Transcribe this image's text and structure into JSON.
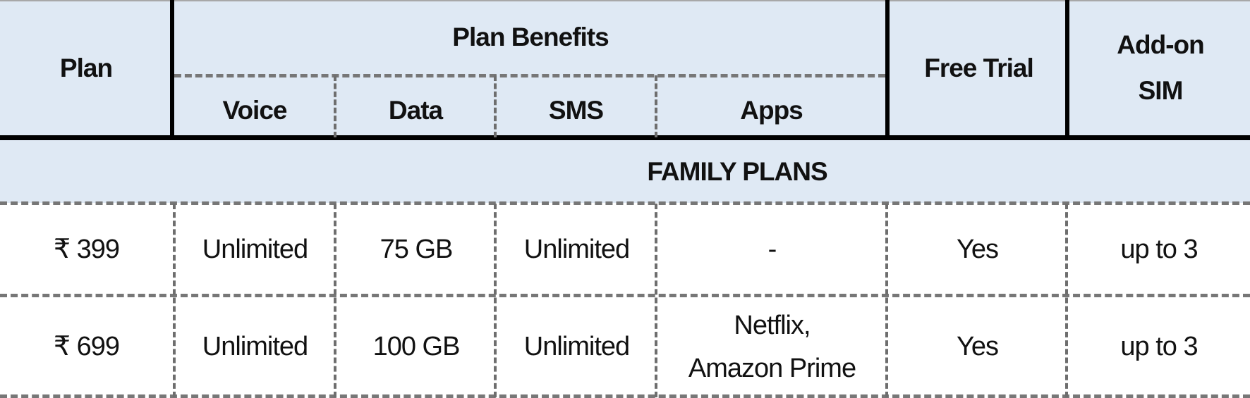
{
  "table": {
    "header": {
      "plan": "Plan",
      "plan_benefits": "Plan Benefits",
      "voice": "Voice",
      "data": "Data",
      "sms": "SMS",
      "apps": "Apps",
      "free_trial": "Free Trial",
      "addon_sim_line1": "Add-on",
      "addon_sim_line2": "SIM"
    },
    "section_title": "FAMILY PLANS",
    "rows": [
      {
        "plan": "₹ 399",
        "voice": "Unlimited",
        "data": "75 GB",
        "sms": "Unlimited",
        "apps_line1": "-",
        "apps_line2": "",
        "free_trial": "Yes",
        "addon_sim": "up to 3"
      },
      {
        "plan": "₹ 699",
        "voice": "Unlimited",
        "data": "100 GB",
        "sms": "Unlimited",
        "apps_line1": "Netflix,",
        "apps_line2": "Amazon Prime",
        "free_trial": "Yes",
        "addon_sim": "up to 3"
      }
    ]
  },
  "colors": {
    "header_fill": "#dfe9f4",
    "body_fill": "#ffffff",
    "border_strong": "#000000",
    "border_light": "#777777"
  }
}
